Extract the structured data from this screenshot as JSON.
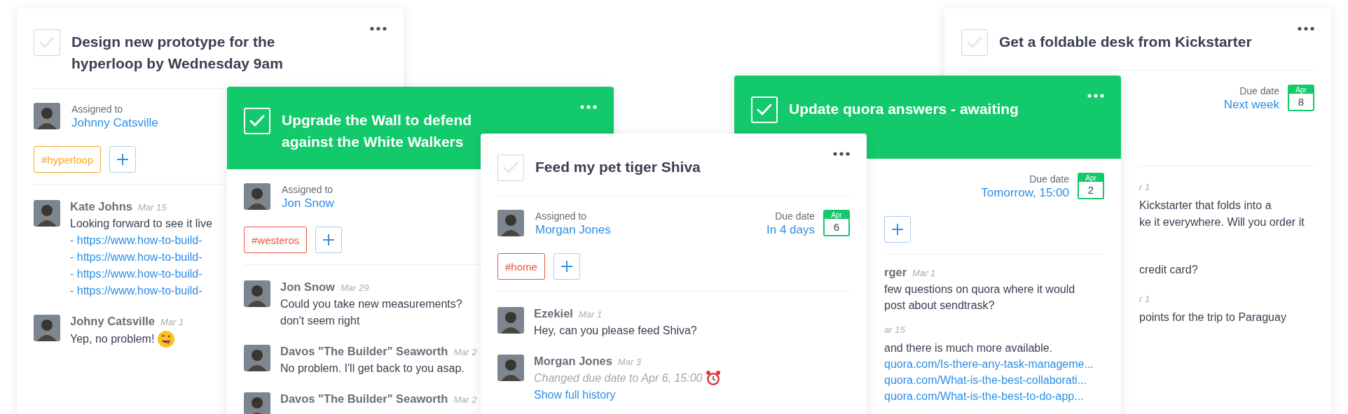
{
  "cards": [
    {
      "title": "Design new prototype for the hyperloop by Wednesday 9am",
      "checked": false,
      "assignee": {
        "label": "Assigned to",
        "name": "Johnny Catsville"
      },
      "tags": [
        {
          "label": "#hyperloop",
          "color": "#f5a623"
        }
      ],
      "add_tag": true,
      "comments": [
        {
          "author": "Kate Johns",
          "date": "Mar 15",
          "lines": [
            {
              "kind": "text",
              "text": "Looking forward to see it live"
            },
            {
              "kind": "link",
              "text": "- https://www.how-to-build-"
            },
            {
              "kind": "link",
              "text": "- https://www.how-to-build-"
            },
            {
              "kind": "link",
              "text": "- https://www.how-to-build-"
            },
            {
              "kind": "link",
              "text": "- https://www.how-to-build-"
            }
          ]
        },
        {
          "author": "Johny Catsville",
          "date": "Mar 1",
          "lines": [
            {
              "kind": "reaction",
              "text": "Yep, no problem!"
            }
          ]
        }
      ]
    },
    {
      "title": "Upgrade the Wall to defend against the White Walkers",
      "checked": true,
      "assignee": {
        "label": "Assigned to",
        "name": "Jon Snow"
      },
      "tags": [
        {
          "label": "#westeros",
          "color": "#f0533a"
        }
      ],
      "add_tag": true,
      "comments": [
        {
          "author": "Jon Snow",
          "date": "Mar 29",
          "lines": [
            {
              "kind": "text",
              "text": "Could you take new measurements?"
            },
            {
              "kind": "text",
              "text": "don't seem right"
            }
          ]
        },
        {
          "author": "Davos \"The Builder\" Seaworth",
          "date": "Mar 2",
          "lines": [
            {
              "kind": "text",
              "text": "No problem. I'll get back to you asap."
            }
          ]
        },
        {
          "author": "Davos \"The Builder\" Seaworth",
          "date": "Mar 2"
        }
      ]
    },
    {
      "title": "Feed my pet tiger Shiva",
      "checked": false,
      "assignee": {
        "label": "Assigned to",
        "name": "Morgan Jones"
      },
      "due": {
        "label": "Due date",
        "value": "In 4 days",
        "month": "Apr",
        "day": "6"
      },
      "tags": [
        {
          "label": "#home",
          "color": "#f0533a"
        }
      ],
      "add_tag": true,
      "comments": [
        {
          "author": "Ezekiel",
          "date": "Mar 1",
          "lines": [
            {
              "kind": "text",
              "text": "Hey, can you please feed Shiva?"
            }
          ]
        },
        {
          "author": "Morgan Jones",
          "date": "Mar 3",
          "lines": [
            {
              "kind": "history",
              "text": "Changed due date to Apr 6, 15:00"
            },
            {
              "kind": "link",
              "text": "Show full history"
            }
          ]
        }
      ]
    },
    {
      "title": "Update quora answers - awaiting",
      "checked": true,
      "due": {
        "label": "Due date",
        "value": "Tomorrow, 15:00",
        "month": "Apr",
        "day": "2"
      },
      "add_tag": true,
      "comments": [
        {
          "author": "rger",
          "date": "Mar 1",
          "lines": [
            {
              "kind": "text",
              "text": "few questions on quora where it would"
            },
            {
              "kind": "text",
              "text": "post about sendtrask?"
            }
          ]
        },
        {
          "date": "ar 15",
          "lines": [
            {
              "kind": "text",
              "text": "and there is much more available."
            },
            {
              "kind": "link",
              "text": "quora.com/Is-there-any-task-manageme..."
            },
            {
              "kind": "link",
              "text": "quora.com/What-is-the-best-collaborati..."
            },
            {
              "kind": "link",
              "text": "quora.com/What-is-the-best-to-do-app..."
            }
          ]
        }
      ]
    },
    {
      "title": "Get a foldable desk from Kickstarter",
      "checked": false,
      "due": {
        "label": "Due date",
        "value": "Next week",
        "month": "Apr",
        "day": "8"
      },
      "add_tag": false,
      "comments": [
        {
          "date": "r 1",
          "lines": [
            {
              "kind": "text",
              "text": "Kickstarter that folds into a"
            },
            {
              "kind": "text",
              "text": "ke it everywhere. Will you order it"
            }
          ]
        },
        {
          "lines": [
            {
              "kind": "text",
              "text": "credit card?"
            }
          ]
        },
        {
          "date": "r 1",
          "lines": [
            {
              "kind": "text",
              "text": "points for the trip to Paraguay"
            }
          ]
        }
      ]
    }
  ]
}
